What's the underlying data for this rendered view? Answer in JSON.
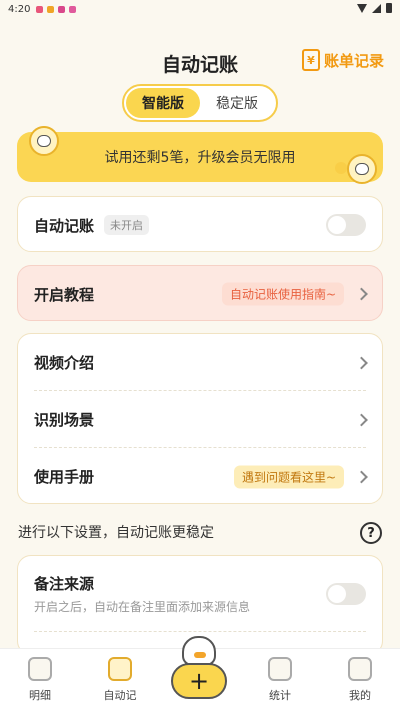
{
  "status": {
    "time": "4:20"
  },
  "header": {
    "title": "自动记账",
    "bill_records": "账单记录",
    "bill_icon_glyph": "¥"
  },
  "segment": {
    "smart": "智能版",
    "stable": "稳定版"
  },
  "trial": {
    "text": "试用还剩5笔，升级会员无限用"
  },
  "auto": {
    "label": "自动记账",
    "status": "未开启"
  },
  "tutorial": {
    "label": "开启教程",
    "guide": "自动记账使用指南~"
  },
  "menu": {
    "video": "视频介绍",
    "scenes": "识别场景",
    "manual": "使用手册",
    "manual_hint": "遇到问题看这里~"
  },
  "settings": {
    "note": "进行以下设置，自动记账更稳定",
    "help_glyph": "?"
  },
  "remark": {
    "label": "备注来源",
    "desc": "开启之后，自动在备注里面添加来源信息"
  },
  "tabs": {
    "details": "明细",
    "auto": "自动记",
    "stats": "统计",
    "mine": "我的",
    "add_glyph": "+"
  },
  "colors": {
    "accent": "#fad64e",
    "orange": "#f29a12",
    "tutorial_bg": "#fde8e1"
  }
}
